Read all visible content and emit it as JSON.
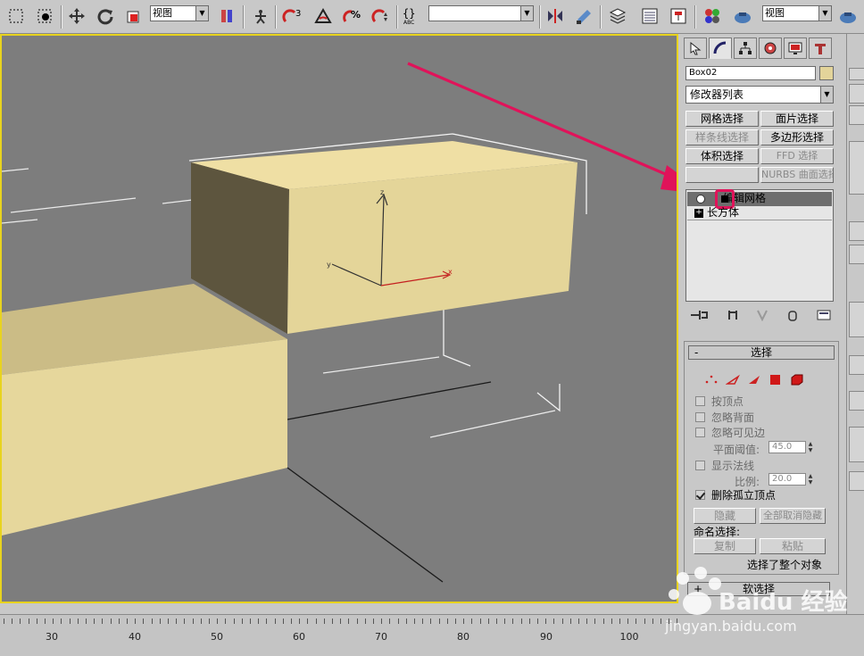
{
  "toolbar": {
    "ref_coord_label": "视图",
    "named_sel_value": "",
    "snap_angle_text": "3",
    "snap_percent_text": "%",
    "view_label": "视图"
  },
  "panel": {
    "object_name": "Box02",
    "object_color": "#e3d49a",
    "modifier_list_label": "修改器列表",
    "buttons": {
      "mesh_select": "网格选择",
      "patch_select": "面片选择",
      "spline_select": "样条线选择",
      "poly_select": "多边形选择",
      "vol_select": "体积选择",
      "ffd_select": "FFD 选择",
      "nurbs_select": "NURBS 曲面选择"
    },
    "stack": {
      "item1": "编辑网格",
      "item2": "长方体"
    }
  },
  "selection_rollout": {
    "title_minus": "-",
    "title": "选择",
    "by_vertex": "按顶点",
    "ignore_backface": "忽略背面",
    "ignore_visible_edges": "忽略可见边",
    "planar_thresh_label": "平面阈值:",
    "planar_thresh_value": "45.0",
    "show_normals": "显示法线",
    "scale_label": "比例:",
    "scale_value": "20.0",
    "delete_isolated": "删除孤立顶点",
    "hide_btn": "隐藏",
    "unhide_all_btn": "全部取消隐藏",
    "named_sel_label": "命名选择:",
    "copy_btn": "复制",
    "paste_btn": "粘贴",
    "status": "选择了整个对象"
  },
  "soft_rollout": {
    "plus": "+",
    "title": "软选择"
  },
  "timeline": {
    "labels": [
      "30",
      "40",
      "50",
      "60",
      "70",
      "80",
      "90",
      "100"
    ]
  },
  "watermark": {
    "brand": "Baidu 经验",
    "url": "jingyan.baidu.com"
  }
}
